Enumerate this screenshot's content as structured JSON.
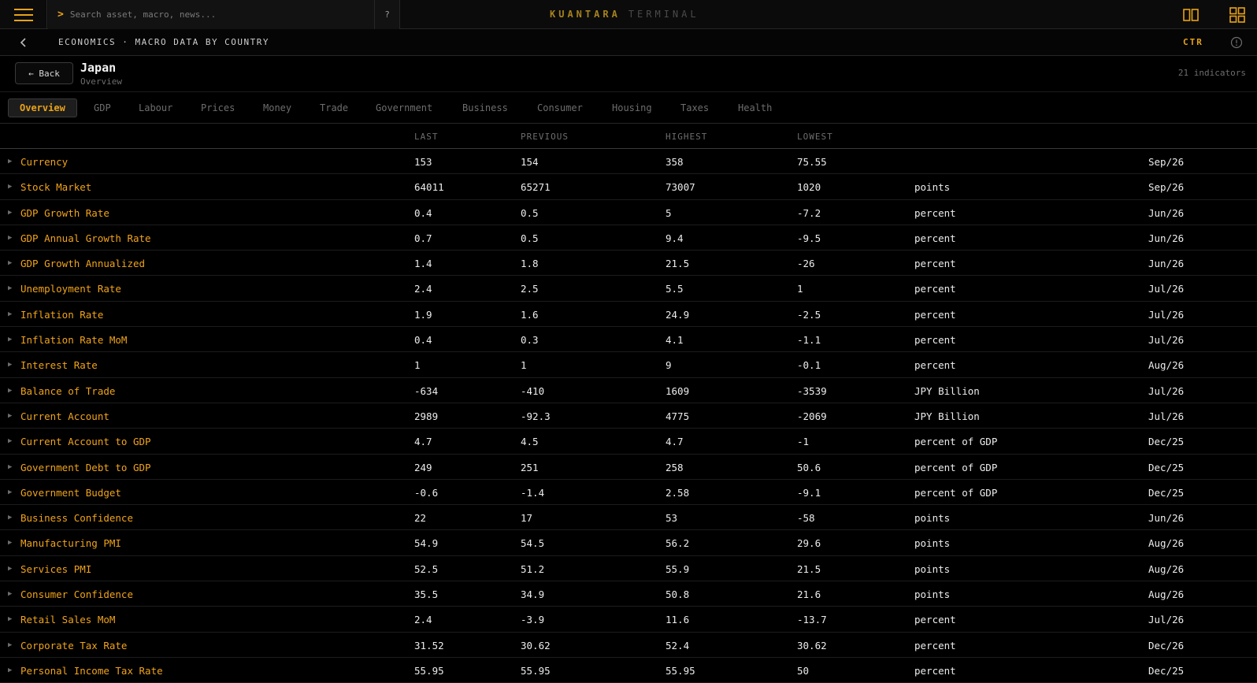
{
  "search": {
    "placeholder": "Search asset, macro, news...",
    "prompt": ">",
    "help": "?"
  },
  "brand": {
    "primary": "KUANTARA",
    "secondary": "TERMINAL"
  },
  "header_icons": [
    "menu-icon",
    "split-view-icon",
    "grid-view-icon"
  ],
  "subbar": {
    "breadcrumb": "ECONOMICS · MACRO DATA BY COUNTRY",
    "ctr": "CTR"
  },
  "country": {
    "back_label": "← Back",
    "name": "Japan",
    "section": "Overview",
    "indicator_count": "21 indicators"
  },
  "tabs": [
    "Overview",
    "GDP",
    "Labour",
    "Prices",
    "Money",
    "Trade",
    "Government",
    "Business",
    "Consumer",
    "Housing",
    "Taxes",
    "Health"
  ],
  "active_tab": "Overview",
  "columns": {
    "last": "LAST",
    "previous": "PREVIOUS",
    "highest": "HIGHEST",
    "lowest": "LOWEST"
  },
  "colors": {
    "accent": "#f0a31a",
    "background": "#000000",
    "muted": "#6d6d6d"
  },
  "rows": [
    {
      "name": "Currency",
      "last": "153",
      "previous": "154",
      "highest": "358",
      "lowest": "75.55",
      "unit": "",
      "date": "Sep/26"
    },
    {
      "name": "Stock Market",
      "last": "64011",
      "previous": "65271",
      "highest": "73007",
      "lowest": "1020",
      "unit": "points",
      "date": "Sep/26"
    },
    {
      "name": "GDP Growth Rate",
      "last": "0.4",
      "previous": "0.5",
      "highest": "5",
      "lowest": "-7.2",
      "unit": "percent",
      "date": "Jun/26"
    },
    {
      "name": "GDP Annual Growth Rate",
      "last": "0.7",
      "previous": "0.5",
      "highest": "9.4",
      "lowest": "-9.5",
      "unit": "percent",
      "date": "Jun/26"
    },
    {
      "name": "GDP Growth Annualized",
      "last": "1.4",
      "previous": "1.8",
      "highest": "21.5",
      "lowest": "-26",
      "unit": "percent",
      "date": "Jun/26"
    },
    {
      "name": "Unemployment Rate",
      "last": "2.4",
      "previous": "2.5",
      "highest": "5.5",
      "lowest": "1",
      "unit": "percent",
      "date": "Jul/26"
    },
    {
      "name": "Inflation Rate",
      "last": "1.9",
      "previous": "1.6",
      "highest": "24.9",
      "lowest": "-2.5",
      "unit": "percent",
      "date": "Jul/26"
    },
    {
      "name": "Inflation Rate MoM",
      "last": "0.4",
      "previous": "0.3",
      "highest": "4.1",
      "lowest": "-1.1",
      "unit": "percent",
      "date": "Jul/26"
    },
    {
      "name": "Interest Rate",
      "last": "1",
      "previous": "1",
      "highest": "9",
      "lowest": "-0.1",
      "unit": "percent",
      "date": "Aug/26"
    },
    {
      "name": "Balance of Trade",
      "last": "-634",
      "previous": "-410",
      "highest": "1609",
      "lowest": "-3539",
      "unit": "JPY Billion",
      "date": "Jul/26"
    },
    {
      "name": "Current Account",
      "last": "2989",
      "previous": "-92.3",
      "highest": "4775",
      "lowest": "-2069",
      "unit": "JPY Billion",
      "date": "Jul/26"
    },
    {
      "name": "Current Account to GDP",
      "last": "4.7",
      "previous": "4.5",
      "highest": "4.7",
      "lowest": "-1",
      "unit": "percent of GDP",
      "date": "Dec/25"
    },
    {
      "name": "Government Debt to GDP",
      "last": "249",
      "previous": "251",
      "highest": "258",
      "lowest": "50.6",
      "unit": "percent of GDP",
      "date": "Dec/25"
    },
    {
      "name": "Government Budget",
      "last": "-0.6",
      "previous": "-1.4",
      "highest": "2.58",
      "lowest": "-9.1",
      "unit": "percent of GDP",
      "date": "Dec/25"
    },
    {
      "name": "Business Confidence",
      "last": "22",
      "previous": "17",
      "highest": "53",
      "lowest": "-58",
      "unit": "points",
      "date": "Jun/26"
    },
    {
      "name": "Manufacturing PMI",
      "last": "54.9",
      "previous": "54.5",
      "highest": "56.2",
      "lowest": "29.6",
      "unit": "points",
      "date": "Aug/26"
    },
    {
      "name": "Services PMI",
      "last": "52.5",
      "previous": "51.2",
      "highest": "55.9",
      "lowest": "21.5",
      "unit": "points",
      "date": "Aug/26"
    },
    {
      "name": "Consumer Confidence",
      "last": "35.5",
      "previous": "34.9",
      "highest": "50.8",
      "lowest": "21.6",
      "unit": "points",
      "date": "Aug/26"
    },
    {
      "name": "Retail Sales MoM",
      "last": "2.4",
      "previous": "-3.9",
      "highest": "11.6",
      "lowest": "-13.7",
      "unit": "percent",
      "date": "Jul/26"
    },
    {
      "name": "Corporate Tax Rate",
      "last": "31.52",
      "previous": "30.62",
      "highest": "52.4",
      "lowest": "30.62",
      "unit": "percent",
      "date": "Dec/26"
    },
    {
      "name": "Personal Income Tax Rate",
      "last": "55.95",
      "previous": "55.95",
      "highest": "55.95",
      "lowest": "50",
      "unit": "percent",
      "date": "Dec/25"
    }
  ]
}
